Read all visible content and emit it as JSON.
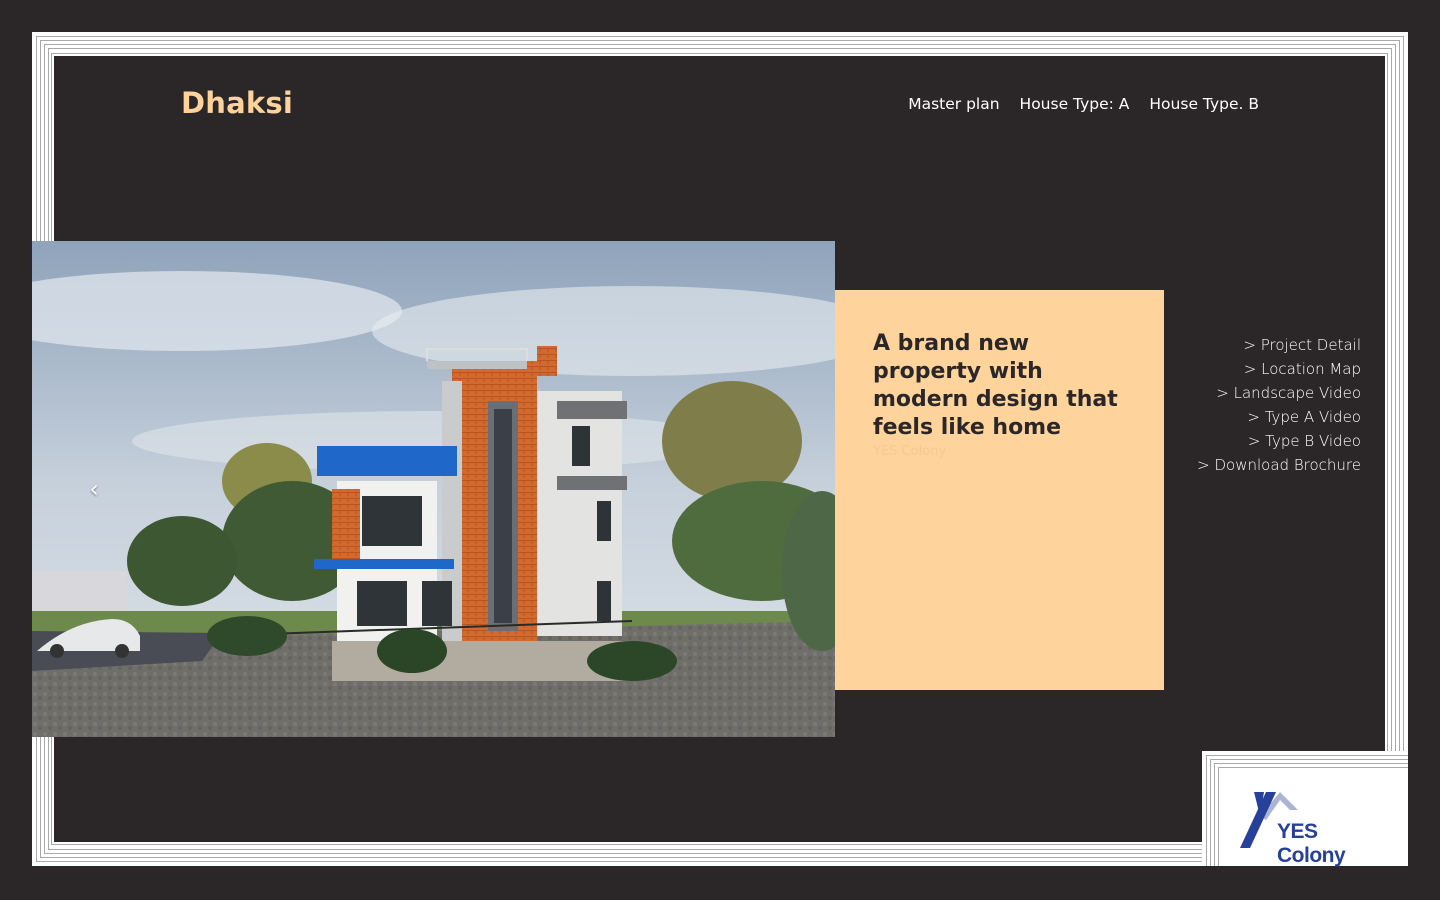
{
  "site": {
    "title": "Dhaksi"
  },
  "nav": {
    "items": [
      "Master plan",
      "House Type: A",
      "House Type. B"
    ]
  },
  "slider": {
    "prev_icon": "chevron-left-icon",
    "image_description_icon": "house-render-image"
  },
  "caption": {
    "heading": "A brand new property with modern design that feels like home",
    "subtext": "YES Colony"
  },
  "side_links": [
    "> Project Detail",
    "> Location Map",
    "> Landscape Video",
    "> Type A Video",
    "> Type B Video",
    "> Download Brochure"
  ],
  "brand": {
    "logo_text": "YES Colony"
  },
  "colors": {
    "background": "#2b2729",
    "accent": "#fdd29b",
    "caption_bg": "#fed39c",
    "logo_blue": "#27409a"
  }
}
